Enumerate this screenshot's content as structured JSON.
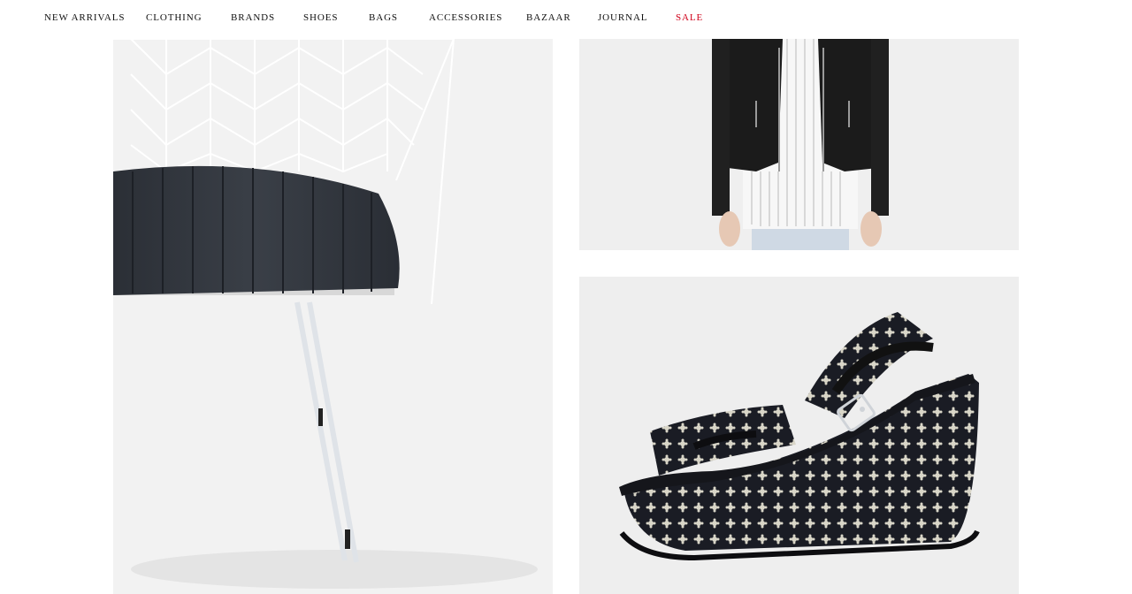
{
  "nav": {
    "items": [
      {
        "label": "NEW ARRIVALS",
        "name": "nav-new-arrivals"
      },
      {
        "label": "CLOTHING",
        "name": "nav-clothing"
      },
      {
        "label": "BRANDS",
        "name": "nav-brands"
      },
      {
        "label": "SHOES",
        "name": "nav-shoes"
      },
      {
        "label": "BAGS",
        "name": "nav-bags"
      },
      {
        "label": "ACCESSORIES",
        "name": "nav-accessories"
      },
      {
        "label": "BAZAAR",
        "name": "nav-bazaar"
      },
      {
        "label": "JOURNAL",
        "name": "nav-journal"
      },
      {
        "label": "SALE",
        "name": "nav-sale"
      }
    ],
    "sale_color": "#d0021b"
  },
  "products": [
    {
      "kind": "chair-image"
    },
    {
      "kind": "jacket-image"
    },
    {
      "kind": "sandal-image"
    }
  ]
}
